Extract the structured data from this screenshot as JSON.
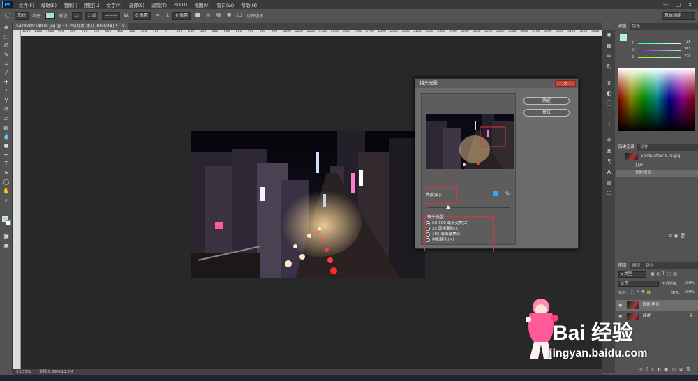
{
  "app": {
    "logo": "Ps"
  },
  "menu": [
    "文件(F)",
    "编辑(E)",
    "图像(I)",
    "图层(L)",
    "文字(Y)",
    "选择(S)",
    "滤镜(T)",
    "3D(D)",
    "视图(V)",
    "窗口(W)",
    "帮助(H)"
  ],
  "window_controls": [
    "—",
    "□",
    "×"
  ],
  "options": {
    "shape_mode": "形状",
    "fill_label": "填充:",
    "stroke_label": "描边:",
    "stroke_width": "1 点",
    "w_label": "W:",
    "w_value": "0 像素",
    "h_label": "H:",
    "h_value": "0 像素",
    "align_edges": "对齐边缘",
    "workspace": "基本功能"
  },
  "document": {
    "tab_title": "54782efc5487b.jpg @ 33.3%(背景 拷贝, RGB/8#) *",
    "tab_close": "×",
    "zoom": "33.33%",
    "doc_info": "文档:6.59M/13.2M"
  },
  "ruler_ticks": [
    "1200",
    "1100",
    "1000",
    "900",
    "800",
    "700",
    "600",
    "500",
    "400",
    "300",
    "200",
    "100",
    "0",
    "100",
    "200",
    "300",
    "400",
    "500",
    "600",
    "700",
    "800",
    "900",
    "1000",
    "1100",
    "1200",
    "1300",
    "1400",
    "1500",
    "1600",
    "1700",
    "1800",
    "1900",
    "2000",
    "2100",
    "2200",
    "2300",
    "2400",
    "2500",
    "2600",
    "2700",
    "2800",
    "2900",
    "3000",
    "3100",
    "3200",
    "3300",
    "3400",
    "3500",
    "3600"
  ],
  "dialog": {
    "title": "镜头光晕",
    "close": "×",
    "ok_label": "确定",
    "reset_label": "复位",
    "brightness_label": "亮度(B):",
    "brightness_value": "",
    "brightness_unit": "%",
    "brightness_fraction": 0.25,
    "lens_type_label": "镜头类型",
    "lens_options": [
      "50-300 毫米变焦(Z)",
      "35 毫米聚焦(K)",
      "105 毫米聚焦(L)",
      "电影镜头(M)"
    ],
    "selected_lens": 0
  },
  "color_panel": {
    "tabs": [
      "颜色",
      "色板"
    ],
    "r_label": "R",
    "r_value": "148",
    "g_label": "G",
    "g_value": "253",
    "b_label": "B",
    "b_value": "220",
    "fg_color": "#94fddc"
  },
  "history_panel": {
    "tabs": [
      "历史记录",
      "动作"
    ],
    "snapshot": "54782efc5487b.jpg",
    "items": [
      "打开",
      "复制图层"
    ]
  },
  "layers_panel": {
    "tabs": [
      "图层",
      "通道",
      "路径"
    ],
    "filter_kind": "ρ 类型",
    "blend_mode": "正常",
    "opacity_label": "不透明度:",
    "opacity_value": "100%",
    "lock_label": "锁定:",
    "fill_label": "填充:",
    "fill_value": "100%",
    "layers": [
      "背景 拷贝",
      "背景"
    ]
  },
  "watermark": {
    "logo_text": "Bai 经验",
    "url": "jingyan.baidu.com"
  }
}
